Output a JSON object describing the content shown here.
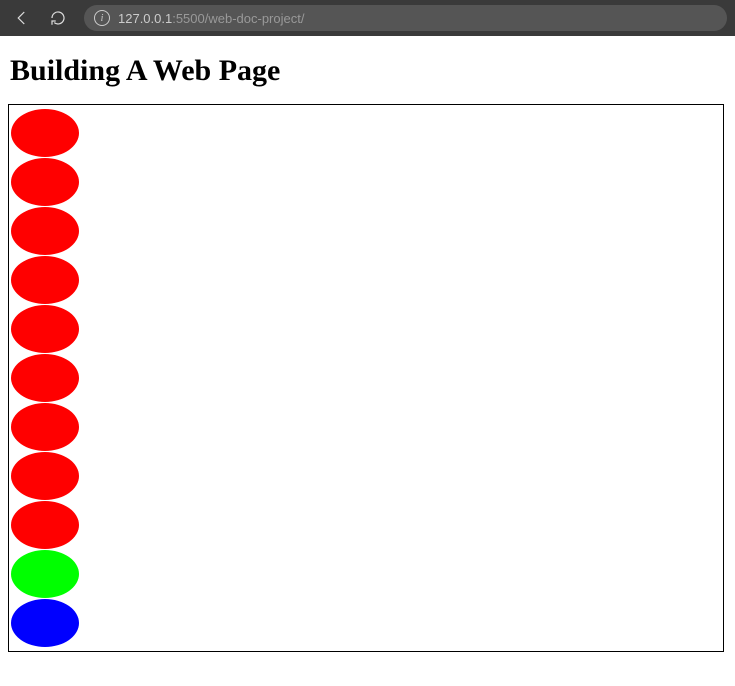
{
  "browser": {
    "url_host": "127.0.0.1",
    "url_rest": ":5500/web-doc-project/"
  },
  "page": {
    "title": "Building A Web Page"
  },
  "ellipses": [
    {
      "color": "#ff0000"
    },
    {
      "color": "#ff0000"
    },
    {
      "color": "#ff0000"
    },
    {
      "color": "#ff0000"
    },
    {
      "color": "#ff0000"
    },
    {
      "color": "#ff0000"
    },
    {
      "color": "#ff0000"
    },
    {
      "color": "#ff0000"
    },
    {
      "color": "#ff0000"
    },
    {
      "color": "#00ff00"
    },
    {
      "color": "#0000ff"
    }
  ]
}
